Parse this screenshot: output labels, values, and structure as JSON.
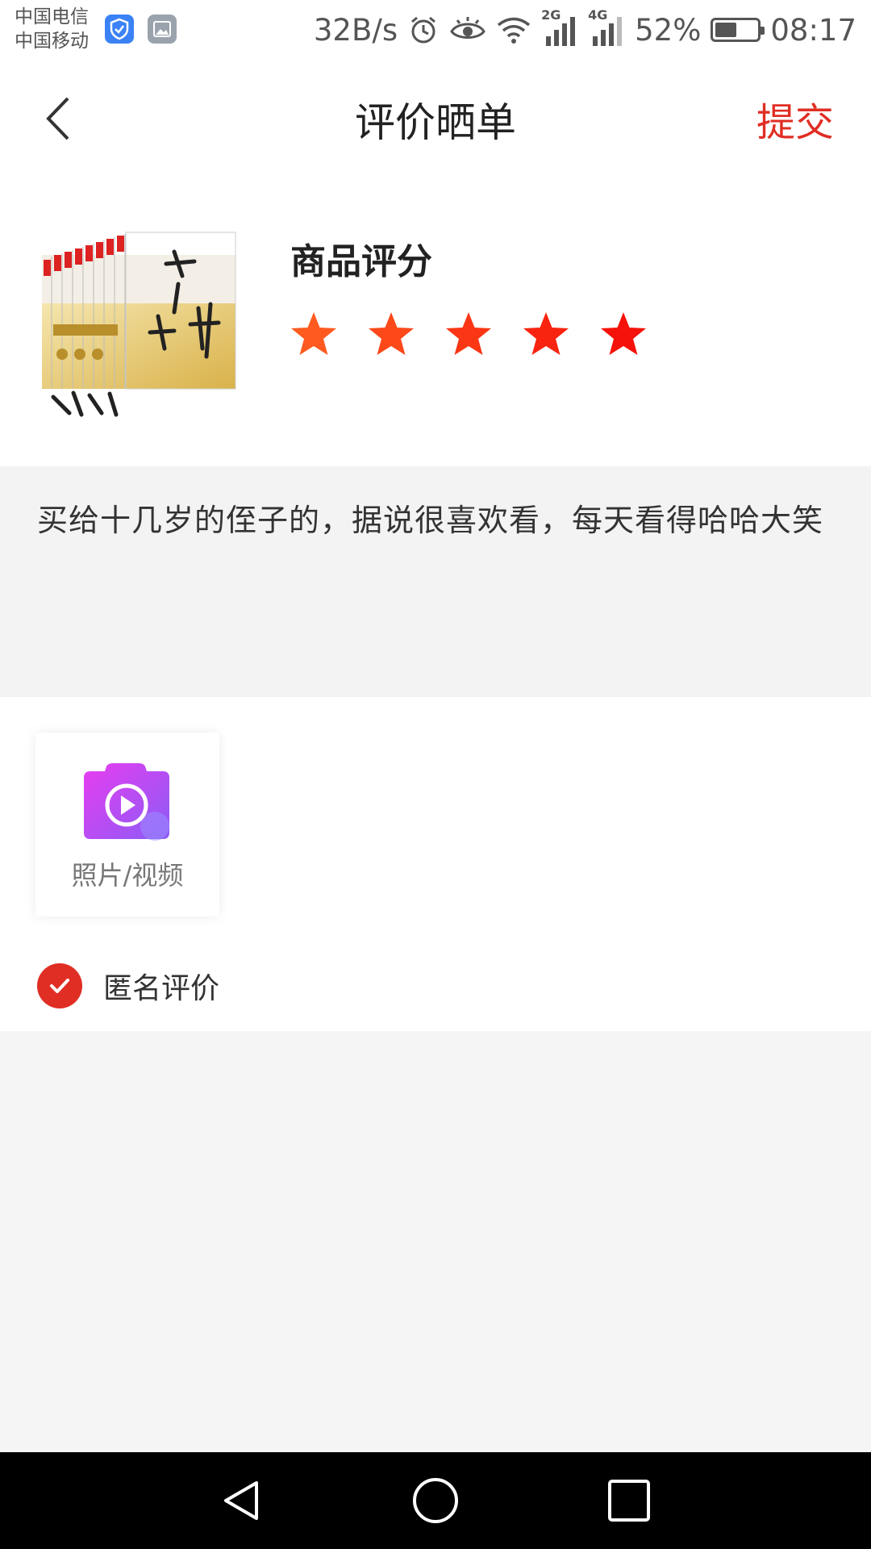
{
  "status_bar": {
    "carrier_1": "中国电信",
    "carrier_2": "中国移动",
    "net_speed": "32B/s",
    "signal_2g": "2G",
    "signal_4g": "4G",
    "battery_percent": "52%",
    "battery_level": 0.52,
    "time": "08:17"
  },
  "header": {
    "title": "评价晒单",
    "submit_label": "提交"
  },
  "product": {
    "rating_label": "商品评分",
    "rating": 5,
    "max_rating": 5
  },
  "review": {
    "text": "买给十几岁的侄子的，据说很喜欢看，每天看得哈哈大笑"
  },
  "media": {
    "upload_label": "照片/视频"
  },
  "anonymous": {
    "label": "匿名评价",
    "checked": true
  },
  "colors": {
    "accent": "#e02e24",
    "star_start": "#ff5a1f",
    "star_end": "#f5120a"
  },
  "icons": {
    "back": "chevron-left-icon",
    "camera": "camera-video-icon",
    "check": "check-icon",
    "nav_back": "triangle-back-icon",
    "nav_home": "circle-home-icon",
    "nav_recent": "square-recent-icon"
  }
}
